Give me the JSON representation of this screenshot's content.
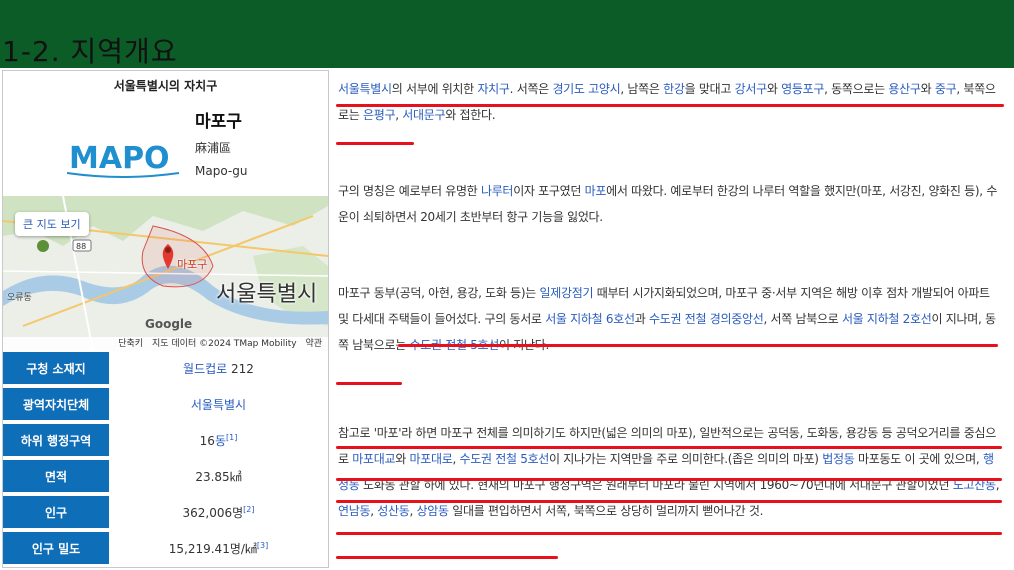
{
  "slide_title": "1-2. 지역개요",
  "infobox": {
    "caption": "서울특별시의 자치구",
    "name": "마포구",
    "hanja": "麻浦區",
    "roman": "Mapo-gu",
    "logo_text": "MAPO",
    "map": {
      "button": "큰 지도 보기",
      "pin_label": "마포구",
      "city_label": "서울특별시",
      "credit_items": [
        "단축키",
        "지도 데이터 ©2024 TMap Mobility",
        "약관"
      ],
      "google": "Google",
      "place_labels": [
        "오류동",
        "88"
      ]
    },
    "rows": [
      {
        "key": "구청 소재지",
        "val_link": "월드컵로",
        "val_text": " 212",
        "sup": ""
      },
      {
        "key": "광역자치단체",
        "val_link": "서울특별시",
        "val_text": "",
        "sup": ""
      },
      {
        "key": "하위 행정구역",
        "val_link": "",
        "val_text": "16",
        "val_link2": "동",
        "sup": "[1]"
      },
      {
        "key": "면적",
        "val_link": "",
        "val_text": "23.85㎢",
        "sup": ""
      },
      {
        "key": "인구",
        "val_link": "",
        "val_text": "362,006명",
        "sup": "[2]"
      },
      {
        "key": "인구 밀도",
        "val_link": "",
        "val_text": "15,219.41명/㎢",
        "sup": "[3]"
      }
    ]
  },
  "paragraphs": {
    "p1": [
      {
        "t": "서울특별시",
        "l": true
      },
      {
        "t": "의 서부에 위치한 "
      },
      {
        "t": "자치구",
        "l": true
      },
      {
        "t": ". 서쪽은 "
      },
      {
        "t": "경기도 고양시",
        "l": true
      },
      {
        "t": ", 남쪽은 "
      },
      {
        "t": "한강",
        "l": true
      },
      {
        "t": "을 맞대고 "
      },
      {
        "t": "강서구",
        "l": true
      },
      {
        "t": "와 "
      },
      {
        "t": "영등포구",
        "l": true
      },
      {
        "t": ", 동쪽으로는 "
      },
      {
        "t": "용산구",
        "l": true
      },
      {
        "t": "와 "
      },
      {
        "t": "중구",
        "l": true
      },
      {
        "t": ", 북쪽으로는 "
      },
      {
        "t": "은평구",
        "l": true
      },
      {
        "t": ", "
      },
      {
        "t": "서대문구",
        "l": true
      },
      {
        "t": "와 접한다."
      }
    ],
    "p2": [
      {
        "t": "구의 명칭은 예로부터 유명한 "
      },
      {
        "t": "나루터",
        "l": true
      },
      {
        "t": "이자 포구였던 "
      },
      {
        "t": "마포",
        "l": true
      },
      {
        "t": "에서 따왔다. 예로부터 한강의 나루터 역할을 했지만(마포, 서강진, 양화진 등), 수운이 쇠퇴하면서 20세기 초반부터 항구 기능을 잃었다."
      }
    ],
    "p3": [
      {
        "t": "마포구 동부(공덕, 아현, 용강, 도화 등)는 "
      },
      {
        "t": "일제강점기",
        "l": true
      },
      {
        "t": " 때부터 시가지화되었으며, 마포구 중·서부 지역은 해방 이후 점차 개발되어 아파트 및 다세대 주택들이 들어섰다. 구의 동서로 "
      },
      {
        "t": "서울 지하철 6호선",
        "l": true
      },
      {
        "t": "과 "
      },
      {
        "t": "수도권 전철 경의중앙선",
        "l": true
      },
      {
        "t": ", 서쪽 남북으로 "
      },
      {
        "t": "서울 지하철 2호선",
        "l": true
      },
      {
        "t": "이 지나며, 동쪽 남북으로는 "
      },
      {
        "t": "수도권 전철 5호선",
        "l": true
      },
      {
        "t": "이 지난다."
      }
    ],
    "p4": [
      {
        "t": "참고로 '마포'라 하면 마포구 전체를 의미하기도 하지만(넓은 의미의 마포), 일반적으로는 공덕동, 도화동, 용강동 등 공덕오거리를 중심으로 "
      },
      {
        "t": "마포대교",
        "l": true
      },
      {
        "t": "와 "
      },
      {
        "t": "마포대로",
        "l": true
      },
      {
        "t": ", "
      },
      {
        "t": "수도권 전철 5호선",
        "l": true
      },
      {
        "t": "이 지나가는 지역만을 주로 의미한다.(좁은 의미의 마포) "
      },
      {
        "t": "법정동",
        "l": true
      },
      {
        "t": " 마포동도 이 곳에 있으며, "
      },
      {
        "t": "행정동",
        "l": true
      },
      {
        "t": " 도화동 관할 하에 있다. 현재의 마포구 행정구역은 원래부터 마포라 불린 지역에서 1960~70년대에 서대문구 관할이었던 "
      },
      {
        "t": "노고산동",
        "l": true
      },
      {
        "t": ", "
      },
      {
        "t": "연남동",
        "l": true
      },
      {
        "t": ", "
      },
      {
        "t": "성산동",
        "l": true
      },
      {
        "t": ", "
      },
      {
        "t": "상암동",
        "l": true
      },
      {
        "t": " 일대를 편입하면서 서쪽, 북쪽으로 상당히 멀리까지 뻗어나간 것."
      }
    ]
  },
  "colors": {
    "topbar": "#0c5c28",
    "key_cell": "#0f6eb8",
    "link": "#2a5cbf",
    "underline": "#e8101a"
  }
}
